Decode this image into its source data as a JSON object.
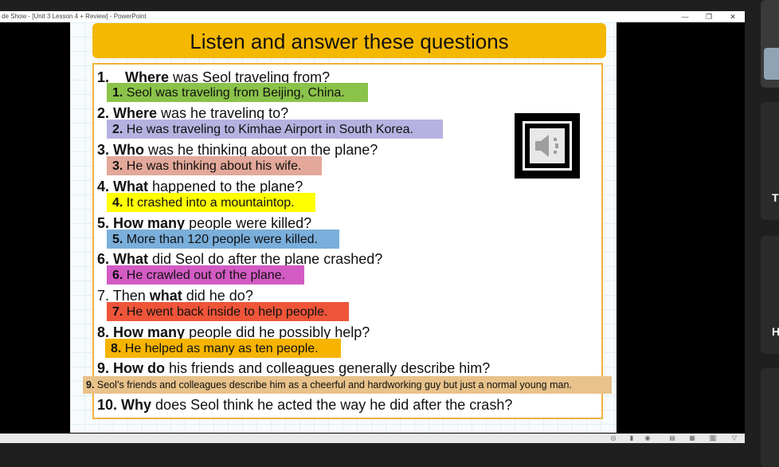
{
  "window": {
    "title": "de Show - [Unit 3 Lesson 4 + Review] - PowerPoint",
    "minimize_glyph": "—",
    "restore_glyph": "❐",
    "close_glyph": "✕"
  },
  "slide": {
    "title": "Listen and answer these questions",
    "questions": [
      {
        "num": "1.",
        "bold": "Where",
        "rest": " was Seol traveling from?"
      },
      {
        "num": "2.",
        "bold": "Where",
        "rest": " was he traveling to?"
      },
      {
        "num": "3.",
        "bold": "Who",
        "rest": " was he thinking about on the plane?"
      },
      {
        "num": "4.",
        "bold": "What",
        "rest": " happened to the plane?"
      },
      {
        "num": "5.",
        "bold": "How many",
        "rest": " people were killed?"
      },
      {
        "num": "6.",
        "bold": "What",
        "rest": " did Seol do after the plane crashed?"
      },
      {
        "num": "7.",
        "pre": "Then ",
        "bold": "what",
        "rest": " did he do?"
      },
      {
        "num": "8.",
        "bold": "How many",
        "rest": " people did he possibly help?"
      },
      {
        "num": "9.",
        "bold": "How do",
        "rest": " his friends and colleagues generally describe him?"
      },
      {
        "num": "10.",
        "bold": "Why",
        "rest": " does Seol think he acted the way he did after the crash?"
      }
    ],
    "answers": [
      {
        "num": "1.",
        "text": "Seol was traveling from Beijing, China.",
        "color": "#8bc34a"
      },
      {
        "num": "2.",
        "text": "He was traveling to Kimhae Airport in South Korea.",
        "color": "#b6b2e0"
      },
      {
        "num": "3.",
        "text": "He was thinking about his wife.",
        "color": "#e3a89a"
      },
      {
        "num": "4.",
        "text": "It crashed into a mountaintop.",
        "color": "#ffff00"
      },
      {
        "num": "5.",
        "text": "More than 120 people were killed.",
        "color": "#7aaedb"
      },
      {
        "num": "6.",
        "text": "He crawled out of the plane.",
        "color": "#d35bc4"
      },
      {
        "num": "7.",
        "text": "He went back inside to help people.",
        "color": "#ef5539"
      },
      {
        "num": "8.",
        "text": "He helped as many as ten people.",
        "color": "#f6b400"
      },
      {
        "num": "9.",
        "text": "Seol’s friends and colleagues describe him as a cheerful and hardworking guy but just a normal young man.",
        "color": "#e8c28a"
      }
    ],
    "speaker_icon": "speaker-icon"
  },
  "right_panel": {
    "letters": [
      "T",
      "H"
    ]
  },
  "statusbar": {
    "icons": [
      "◎",
      "▮",
      "◉",
      "▤",
      "▦",
      "▥",
      "▽"
    ]
  }
}
